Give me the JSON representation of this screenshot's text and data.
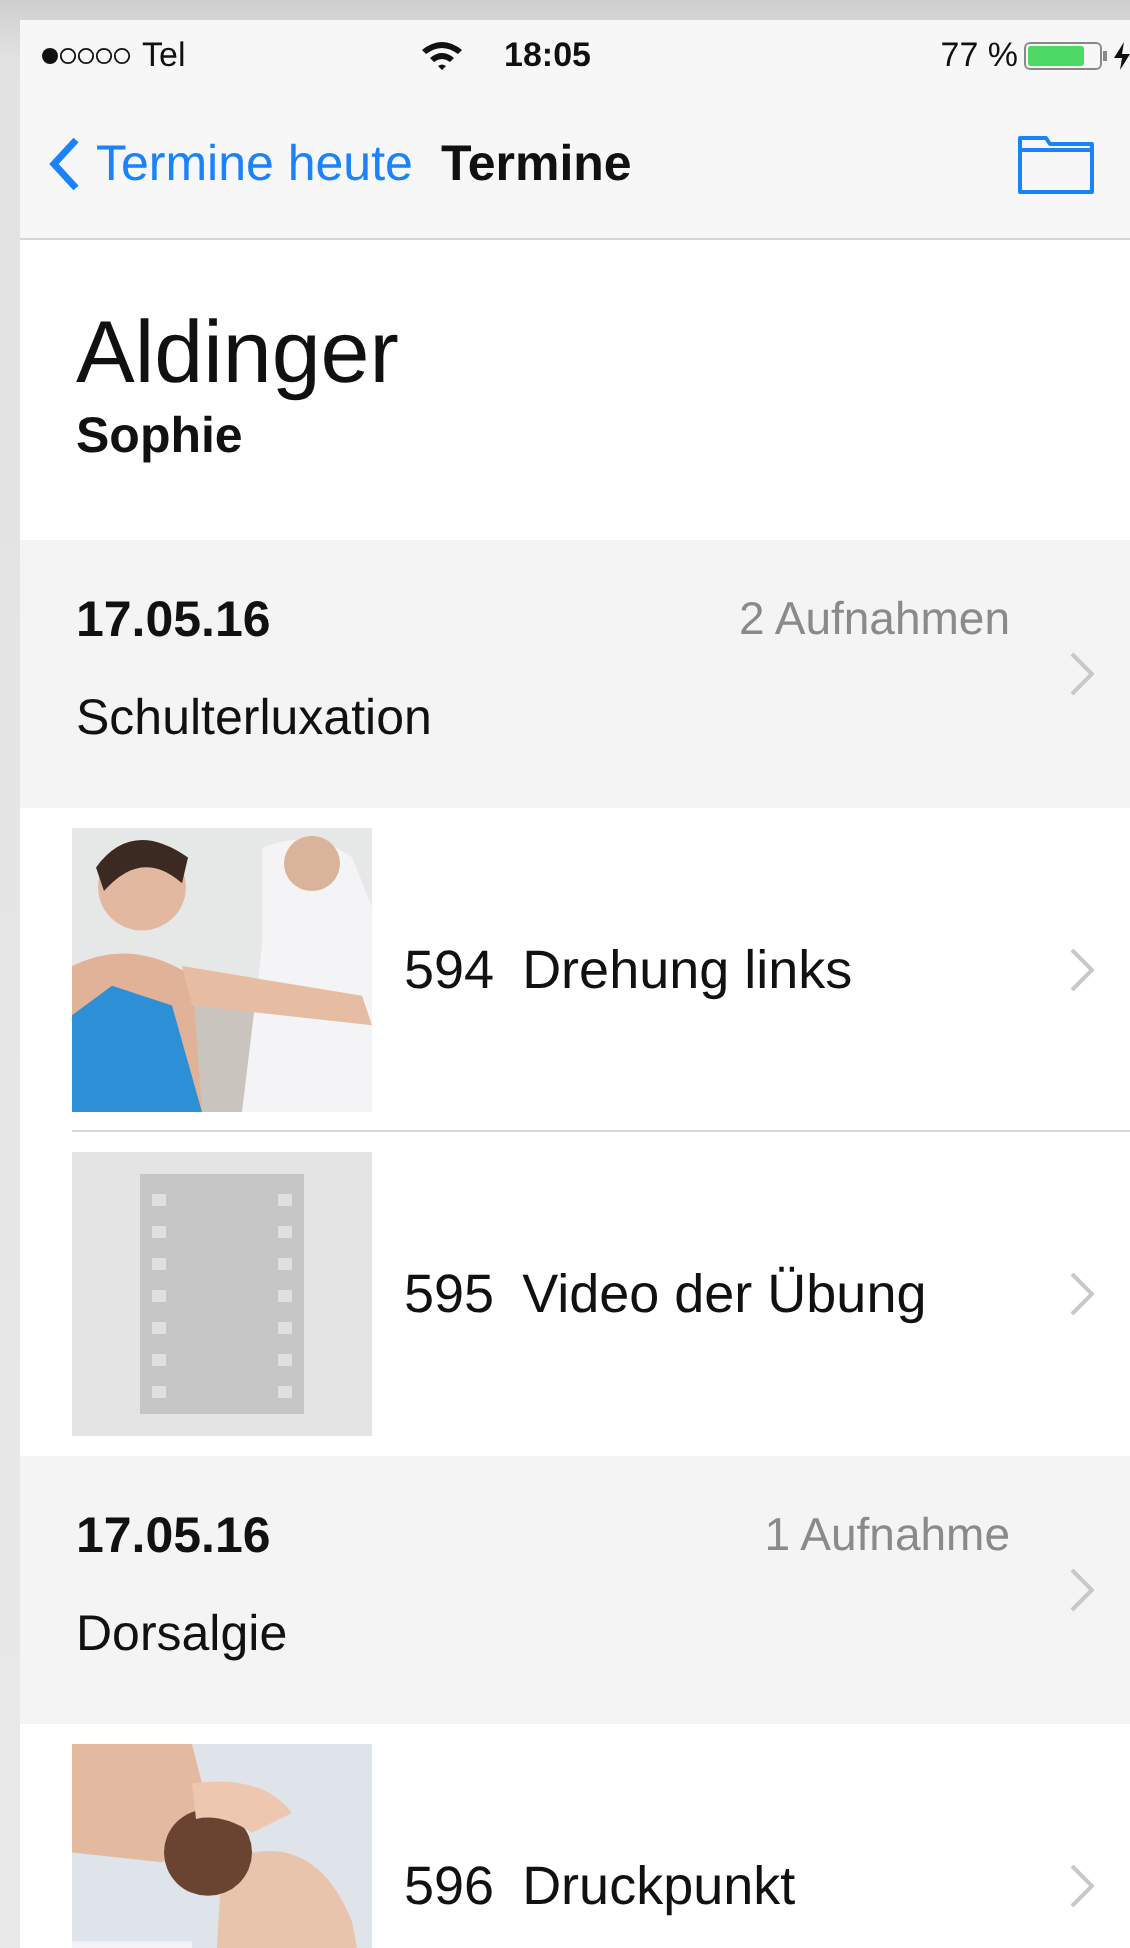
{
  "status_bar": {
    "carrier": "Tel",
    "time": "18:05",
    "battery": "77 %"
  },
  "nav": {
    "back": "Termine heute",
    "title": "Termine"
  },
  "patient": {
    "last_name": "Aldinger",
    "first_name": "Sophie"
  },
  "groups": [
    {
      "date": "17.05.16",
      "count": "2 Aufnahmen",
      "diagnosis": "Schulterluxation",
      "items": [
        {
          "number": "594",
          "title": "Drehung links"
        },
        {
          "kind": "video",
          "number": "595",
          "title": "Video der Übung"
        }
      ]
    },
    {
      "date": "17.05.16",
      "count": "1 Aufnahme",
      "diagnosis": "Dorsalgie",
      "items": [
        {
          "kind": "photo2",
          "number": "596",
          "title": "Druckpunkt"
        }
      ]
    }
  ]
}
